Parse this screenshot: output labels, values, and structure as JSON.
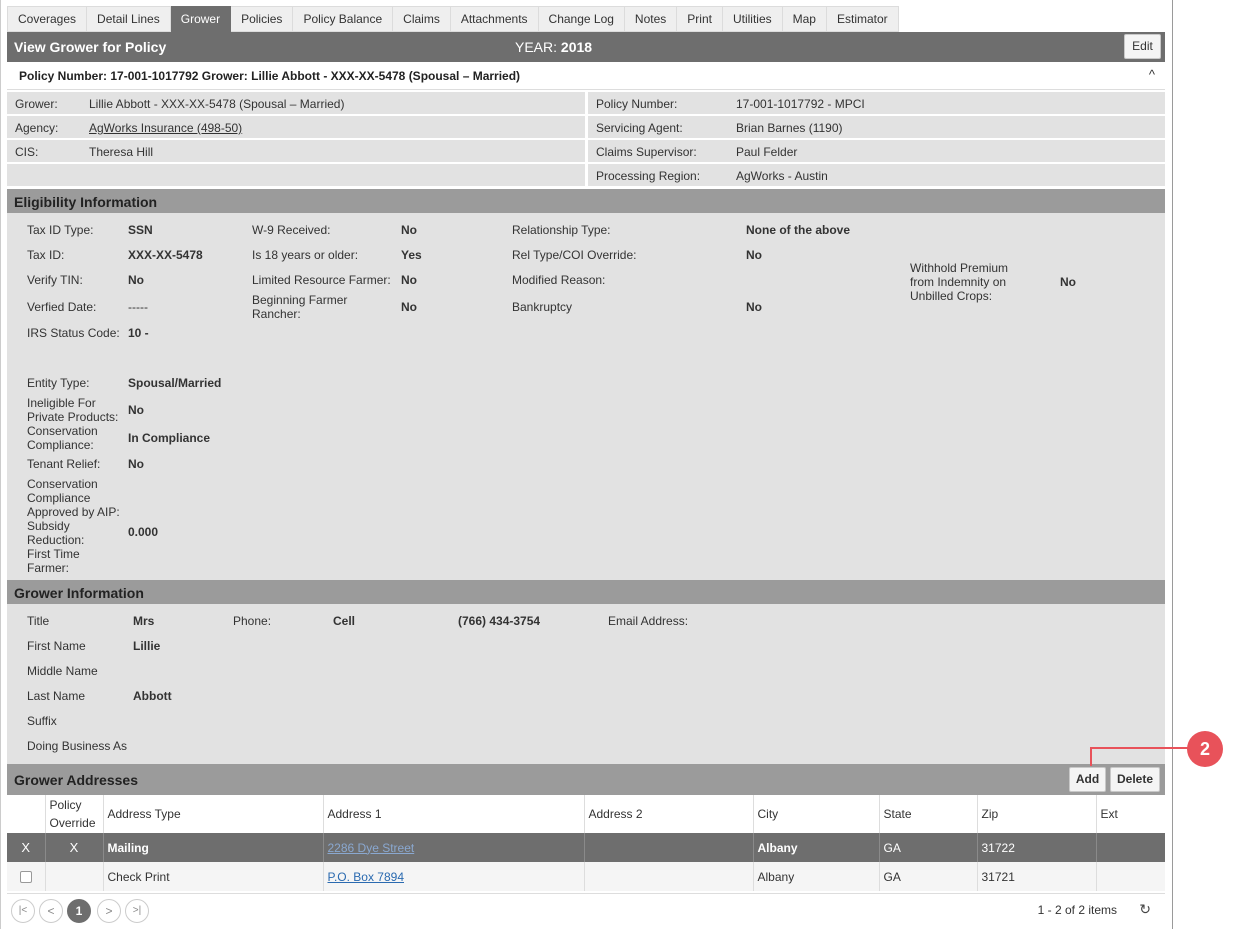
{
  "tabs": [
    "Coverages",
    "Detail Lines",
    "Grower",
    "Policies",
    "Policy Balance",
    "Claims",
    "Attachments",
    "Change Log",
    "Notes",
    "Print",
    "Utilities",
    "Map",
    "Estimator"
  ],
  "header": {
    "title": "View Grower for Policy",
    "year_label": "YEAR:",
    "year": "2018",
    "edit": "Edit"
  },
  "policy_bar": {
    "text": "Policy Number: 17-001-1017792 Grower: Lillie Abbott - XXX-XX-5478 (Spousal – Married)",
    "caret": "^"
  },
  "info": {
    "grower_l": "Grower:",
    "grower": "Lillie Abbott - XXX-XX-5478 (Spousal – Married)",
    "agency_l": "Agency:",
    "agency": "AgWorks Insurance (498-50)",
    "cis_l": "CIS:",
    "cis": "Theresa Hill",
    "policy_l": "Policy Number:",
    "policy": "17-001-1017792 - MPCI",
    "agent_l": "Servicing Agent:",
    "agent": "Brian Barnes (1190)",
    "claims_l": "Claims Supervisor:",
    "claims": "Paul Felder",
    "region_l": "Processing Region:",
    "region": "AgWorks - Austin"
  },
  "eligibility": {
    "title": "Eligibility Information",
    "tax_type_l": "Tax ID Type:",
    "tax_type": "SSN",
    "tax_id_l": "Tax ID:",
    "tax_id": "XXX-XX-5478",
    "verify_l": "Verify TIN:",
    "verify": "No",
    "verified_l": "Verfied Date:",
    "verified": "-----",
    "irs_l": "IRS Status Code:",
    "irs": "10 -",
    "entity_l": "Entity Type:",
    "entity": "Spousal/Married",
    "inelig_l1": "Ineligible For",
    "inelig_l2": "Private Products:",
    "inelig": "No",
    "cons_l1": "Conservation",
    "cons_l2": "Compliance:",
    "cons": "In Compliance",
    "tenant_l": "Tenant Relief:",
    "tenant": "No",
    "caa_l1": "Conservation",
    "caa_l2": "Compliance",
    "caa_l3": "Approved by AIP:",
    "subsidy_l1": "Subsidy",
    "subsidy_l2": "Reduction:",
    "subsidy": "0.000",
    "ftf_l1": "First Time",
    "ftf_l2": "Farmer:",
    "w9_l": "W-9 Received:",
    "w9": "No",
    "age_l": "Is 18 years or older:",
    "age": "Yes",
    "lrf_l": "Limited Resource Farmer:",
    "lrf": "No",
    "bfr_l1": "Beginning Farmer",
    "bfr_l2": "Rancher:",
    "bfr": "No",
    "rel_l": "Relationship Type:",
    "rel": "None of the above",
    "coi_l": "Rel Type/COI Override:",
    "coi": "No",
    "mod_l": "Modified Reason:",
    "bank_l": "Bankruptcy",
    "bank": "No",
    "wh_l1": "Withhold Premium",
    "wh_l2": "from Indemnity on",
    "wh_l3": "Unbilled Crops:",
    "wh": "No"
  },
  "grower_info": {
    "title": "Grower Information",
    "title_l": "Title",
    "title_v": "Mrs",
    "first_l": "First Name",
    "first_v": "Lillie",
    "middle_l": "Middle Name",
    "last_l": "Last Name",
    "last_v": "Abbott",
    "suffix_l": "Suffix",
    "dba_l": "Doing Business As",
    "phone_l": "Phone:",
    "phone_type": "Cell",
    "phone": "(766) 434-3754",
    "email_l": "Email Address:"
  },
  "addresses": {
    "title": "Grower Addresses",
    "add": "Add",
    "delete": "Delete",
    "headers": {
      "h1a": "Policy",
      "h1b": "Override",
      "h2": "Address Type",
      "h3": "Address 1",
      "h4": "Address 2",
      "h5": "City",
      "h6": "State",
      "h7": "Zip",
      "h8": "Ext"
    },
    "rows": [
      {
        "c0": "X",
        "c1": "X",
        "type": "Mailing",
        "a1": "2286 Dye Street",
        "a2": "",
        "city": "Albany",
        "state": "GA",
        "zip": "31722",
        "ext": ""
      },
      {
        "c0": "",
        "c1": "",
        "type": "Check Print",
        "a1": "P.O. Box 7894",
        "a2": "",
        "city": "Albany",
        "state": "GA",
        "zip": "31721",
        "ext": ""
      }
    ]
  },
  "pager": {
    "first": "|<",
    "prev": "<",
    "page": "1",
    "next": ">",
    "last": ">|",
    "count": "1 - 2 of 2 items",
    "refresh": "↻"
  },
  "callout": "2"
}
